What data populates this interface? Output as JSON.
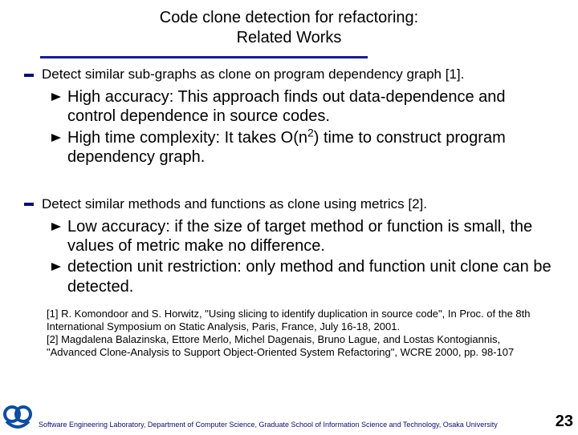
{
  "title_line1": "Code clone detection for refactoring:",
  "title_line2": "Related Works",
  "sections": [
    {
      "heading": "Detect similar sub-graphs as clone on program dependency graph [1].",
      "points": [
        "High accuracy: This approach finds out data-dependence and control dependence in source codes.",
        "High time complexity: It takes O(n2) time to construct program dependency graph."
      ]
    },
    {
      "heading": "Detect similar methods and functions as clone using metrics [2].",
      "points": [
        "Low accuracy: if the size of target method or function is small,  the values of metric make no difference.",
        "detection unit restriction: only method and function unit clone can be detected."
      ]
    }
  ],
  "references": [
    "[1] R. Komondoor and S. Horwitz, \"Using slicing to identify duplication in  source code\", In Proc. of the 8th International Symposium on Static Analysis, Paris, France, July 16-18, 2001.",
    "[2] Magdalena Balazinska, Ettore Merlo, Michel Dagenais, Bruno Lague, and Lostas Kontogiannis, \"Advanced Clone-Analysis to Support Object-Oriented System Refactoring\", WCRE 2000, pp. 98-107"
  ],
  "footer_credit": "Software Engineering Laboratory, Department of Computer Science, Graduate School of Information Science and Technology, Osaka University",
  "page_number": "23"
}
